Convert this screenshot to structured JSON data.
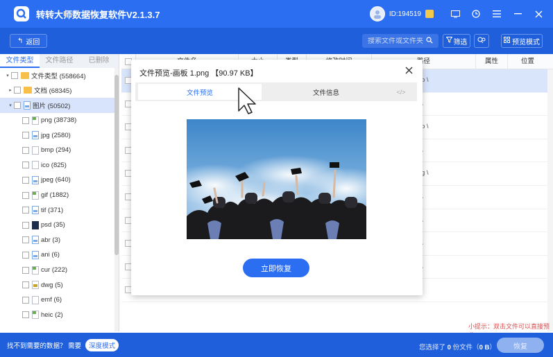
{
  "app": {
    "title": "转转大师数据恢复软件V2.1.3.7",
    "user_id": "ID:194519"
  },
  "toolbar": {
    "back_label": "返回",
    "search_placeholder": "搜索文件或文件夹",
    "filter_label": "筛选",
    "preview_mode_label": "预览模式"
  },
  "sidebar": {
    "tabs": [
      "文件类型",
      "文件路径",
      "已删除"
    ],
    "tree": [
      {
        "label": "文件类型 (558664)",
        "level": 0,
        "icon": "folder-icon",
        "arrow": "▾"
      },
      {
        "label": "文档 (68345)",
        "level": 1,
        "icon": "folder-icon",
        "arrow": "▸"
      },
      {
        "label": "图片 (50502)",
        "level": 1,
        "icon": "image-icon",
        "arrow": "▾",
        "selected": true
      },
      {
        "label": "png (38738)",
        "level": 2,
        "icon": "png-file-icon"
      },
      {
        "label": "jpg (2580)",
        "level": 2,
        "icon": "jpg-file-icon"
      },
      {
        "label": "bmp (294)",
        "level": 2,
        "icon": "bmp-file-icon"
      },
      {
        "label": "ico (825)",
        "level": 2,
        "icon": "ico-file-icon"
      },
      {
        "label": "jpeg (640)",
        "level": 2,
        "icon": "jpeg-file-icon"
      },
      {
        "label": "gif (1882)",
        "level": 2,
        "icon": "gif-file-icon"
      },
      {
        "label": "tif (371)",
        "level": 2,
        "icon": "tif-file-icon"
      },
      {
        "label": "psd (35)",
        "level": 2,
        "icon": "psd-file-icon"
      },
      {
        "label": "abr (3)",
        "level": 2,
        "icon": "abr-file-icon"
      },
      {
        "label": "ani (6)",
        "level": 2,
        "icon": "ani-file-icon"
      },
      {
        "label": "cur (222)",
        "level": 2,
        "icon": "cur-file-icon"
      },
      {
        "label": "dwg (5)",
        "level": 2,
        "icon": "dwg-file-icon"
      },
      {
        "label": "emf (6)",
        "level": 2,
        "icon": "emf-file-icon"
      },
      {
        "label": "heic (2)",
        "level": 2,
        "icon": "heic-file-icon"
      }
    ]
  },
  "table": {
    "columns": [
      "文件名",
      "大小",
      "类型",
      "修改时间",
      "路径",
      "属性",
      "位置"
    ],
    "rows": [
      {
        "path": "p \\",
        "selected": true
      },
      {
        "path": "\\"
      },
      {
        "path": "p \\"
      },
      {
        "path": "\\"
      },
      {
        "path": "g \\"
      },
      {
        "path": "\\"
      },
      {
        "path": "\\"
      },
      {
        "path": "\\"
      },
      {
        "path": "\\"
      },
      {
        "path": ""
      }
    ]
  },
  "tip": "小提示：双击文件可以直接预览。",
  "bottom": {
    "not_found": "找不到需要的数据？ 需要",
    "deep_mode": "深度模式",
    "selected_prefix": "您选择了",
    "selected_count": "0",
    "selected_mid": "份文件（",
    "selected_size": "0 B",
    "selected_suffix": "）",
    "recover_label": "恢复"
  },
  "dialog": {
    "title": "文件预览-画板 1.png 【90.97 KB】",
    "tabs": {
      "preview": "文件预览",
      "info": "文件信息",
      "code": "</>"
    },
    "restore_label": "立即恢复"
  },
  "colors": {
    "primary": "#2c6ef2",
    "toolbar": "#1f5fdc",
    "tip": "#e24b4b"
  }
}
